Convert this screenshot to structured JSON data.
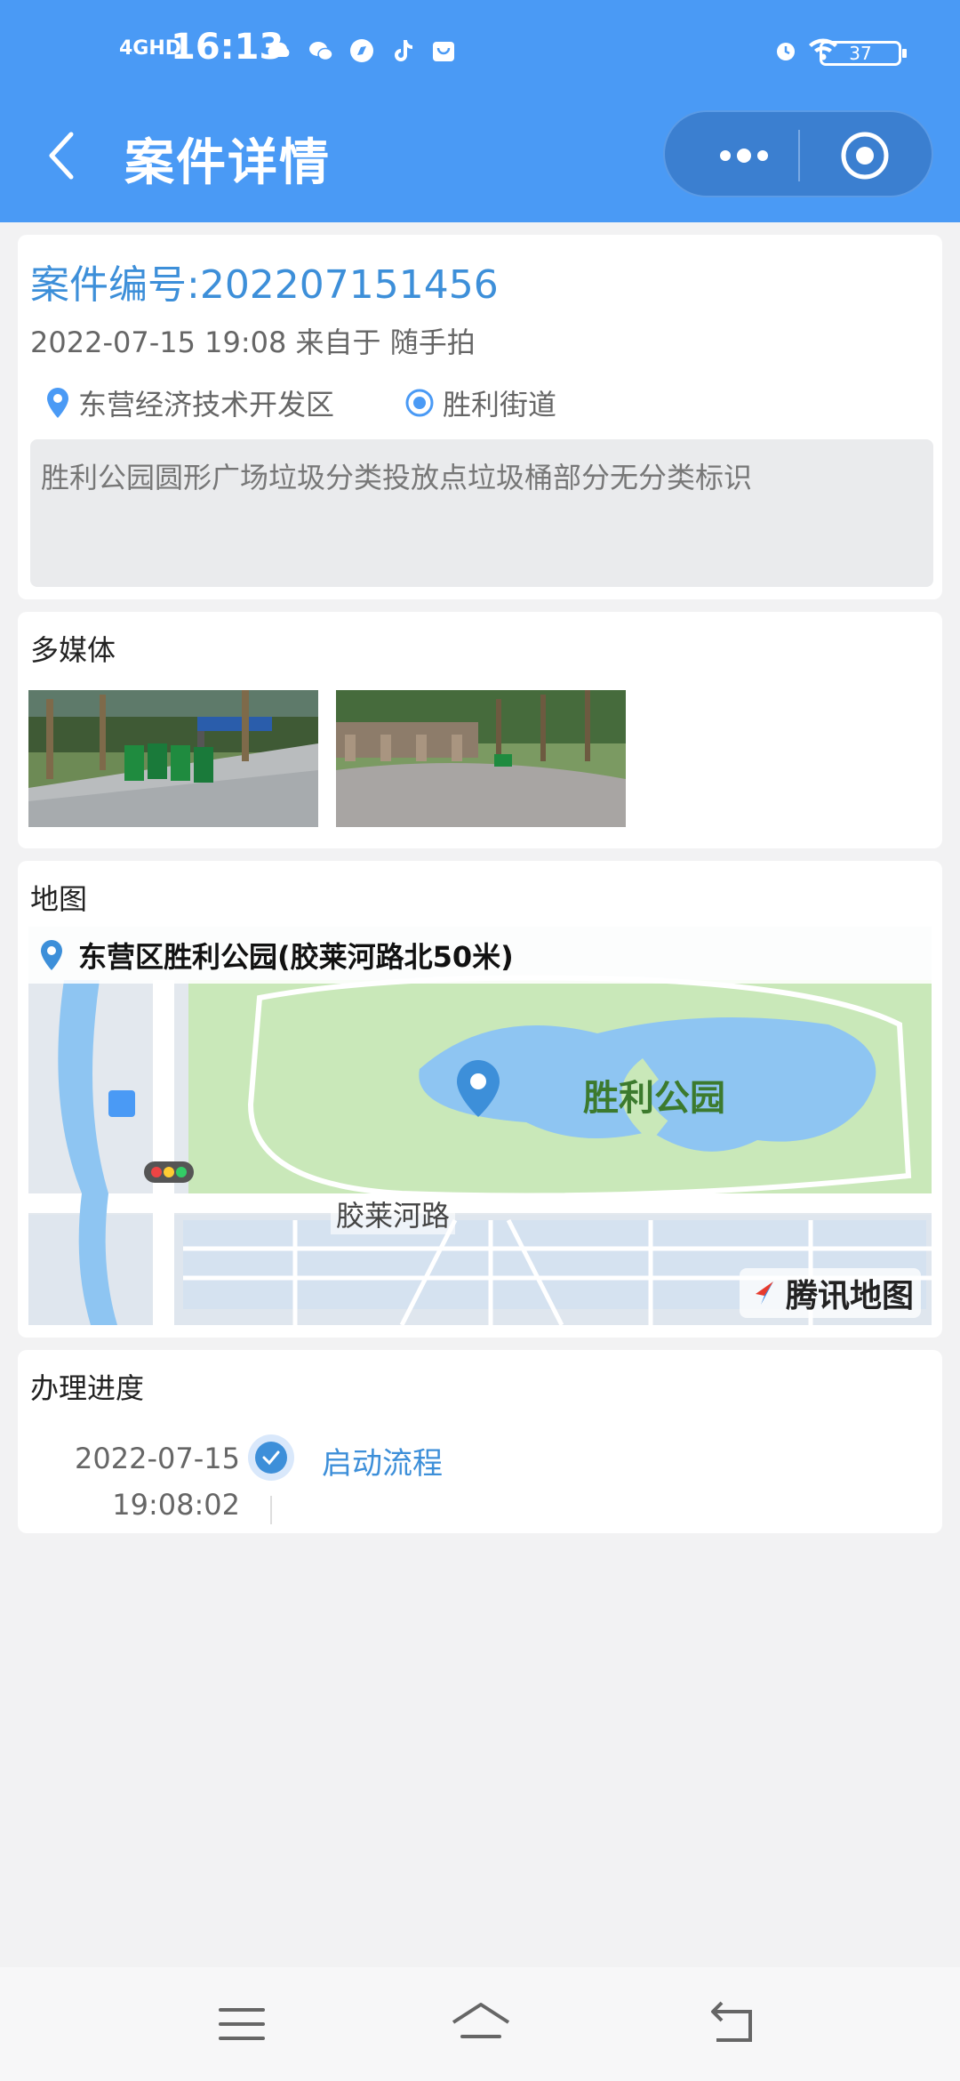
{
  "status": {
    "signal": "4GHD",
    "time": "16:13",
    "battery": "37"
  },
  "nav": {
    "title": "案件详情"
  },
  "case": {
    "number": "案件编号:202207151456",
    "meta": "2022-07-15 19:08 来自于 随手拍",
    "district": "东营经济技术开发区",
    "street": "胜利街道",
    "description": "胜利公园圆形广场垃圾分类投放点垃圾桶部分无分类标识"
  },
  "media": {
    "title": "多媒体"
  },
  "map": {
    "title": "地图",
    "address": "东营区胜利公园(胶莱河路北50米)",
    "park_label": "胜利公园",
    "road_label": "胶莱河路",
    "logo_text": "腾讯地图"
  },
  "progress": {
    "title": "办理进度",
    "steps": [
      {
        "date": "2022-07-15",
        "time": "19:08:02",
        "label": "启动流程"
      }
    ]
  },
  "colors": {
    "header": "#4a9af5",
    "accent": "#3d8fd9",
    "background": "#f2f2f3"
  }
}
